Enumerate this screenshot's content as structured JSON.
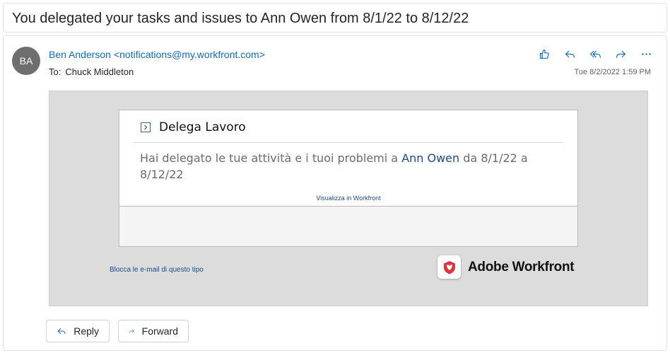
{
  "subject": "You delegated your tasks and issues to Ann Owen from 8/1/22 to 8/12/22",
  "sender": {
    "initials": "BA",
    "name": "Ben Anderson",
    "email": "<notifications@my.workfront.com>"
  },
  "recipient": {
    "to_label": "To:",
    "name": "Chuck Middleton"
  },
  "timestamp": "Tue 8/2/2022 1:59 PM",
  "actions": [
    "like-icon",
    "reply-icon",
    "reply-all-icon",
    "forward-icon",
    "more-icon"
  ],
  "email_body": {
    "card_title": "Delega Lavoro",
    "text_before": "Hai delegato le tue attività e i tuoi problemi a",
    "delegate_link": "Ann Owen",
    "text_after": "da 8/1/22 a 8/12/22",
    "view_link": "Visualizza in Workfront",
    "block_link": "Blocca le e-mail di questo tipo",
    "brand_name": "Adobe Workfront"
  },
  "buttons": {
    "reply": "Reply",
    "forward": "Forward"
  },
  "colors": {
    "accent": "#0f6cbd",
    "link": "#1b4a8b",
    "avatar_bg": "#6e6e6e",
    "brand_red": "#d7373f"
  }
}
